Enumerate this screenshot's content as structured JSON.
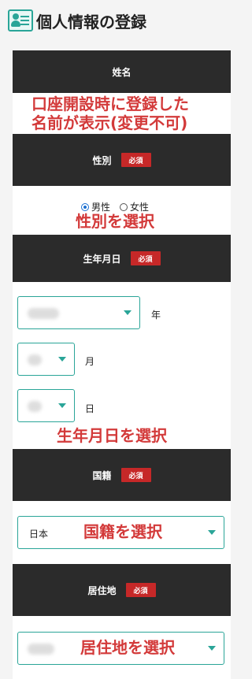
{
  "header": {
    "title": "個人情報の登録",
    "icon": "user-card-icon"
  },
  "name_section": {
    "label": "姓名",
    "note_line1": "口座開設時に登録した",
    "note_line2": "名前が表示(変更不可)"
  },
  "gender_section": {
    "label": "性別",
    "required": "必須",
    "options": [
      {
        "label": "男性",
        "checked": true
      },
      {
        "label": "女性",
        "checked": false
      }
    ],
    "note": "性別を選択"
  },
  "birthdate_section": {
    "label": "生年月日",
    "required": "必須",
    "year_unit": "年",
    "month_unit": "月",
    "day_unit": "日",
    "note": "生年月日を選択"
  },
  "nationality_section": {
    "label": "国籍",
    "required": "必須",
    "value": "日本",
    "note": "国籍を選択"
  },
  "residence_section": {
    "label": "居住地",
    "required": "必須",
    "note": "居住地を選択"
  },
  "colors": {
    "accent": "#2aa598",
    "header_bg": "#2b2b2b",
    "badge": "#c62828",
    "annotation": "#d33a3a"
  }
}
